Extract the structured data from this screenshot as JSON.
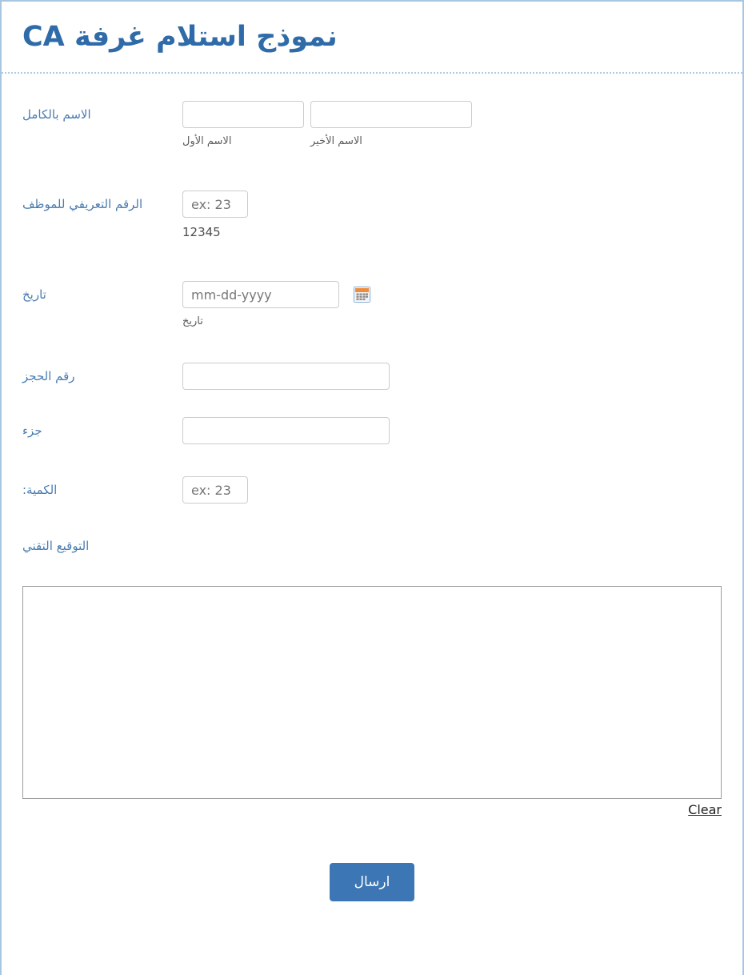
{
  "header": {
    "title": "نموذج استلام غرفة CA",
    "title_color": "#2f6ba8"
  },
  "theme": {
    "page_border_color": "#a9c6e0",
    "label_color": "#4a7cb0",
    "accent_button_color": "#3c76b5",
    "input_border_color": "#ccccd0",
    "sub_label_color": "#5c5c5c"
  },
  "fields": {
    "full_name": {
      "label": "الاسم بالكامل",
      "first": {
        "value": "",
        "placeholder": "",
        "sub_label": "الاسم الأول"
      },
      "last": {
        "value": "",
        "placeholder": "",
        "sub_label": "الاسم الأخير"
      }
    },
    "employee_id": {
      "label": "الرقم التعريفي للموظف",
      "value": "",
      "placeholder": "ex: 23",
      "sub_label": "12345"
    },
    "date": {
      "label": "تاريخ",
      "value": "",
      "placeholder": "mm-dd-yyyy",
      "sub_label": "تاريخ",
      "picker_icon": "calendar-icon"
    },
    "booking_number": {
      "label": "رقم الحجز",
      "value": "",
      "placeholder": ""
    },
    "part": {
      "label": "جزء",
      "value": "",
      "placeholder": ""
    },
    "quantity": {
      "label": "الكمية:",
      "value": "",
      "placeholder": "ex: 23"
    },
    "technical_signature": {
      "label": "التوقيع التقني",
      "clear_label": "Clear"
    }
  },
  "submit": {
    "label": "ارسال"
  }
}
